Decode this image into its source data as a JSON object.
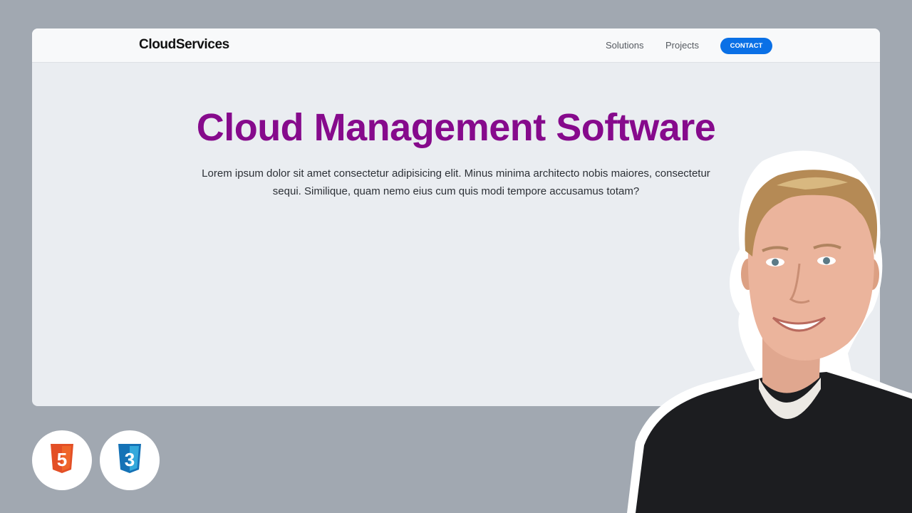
{
  "navbar": {
    "brand": "CloudServices",
    "links": [
      {
        "label": "Solutions"
      },
      {
        "label": "Projects"
      }
    ],
    "cta_label": "CONTACT"
  },
  "hero": {
    "title": "Cloud Management Software",
    "text": "Lorem ipsum dolor sit amet consectetur adipisicing elit. Minus minima architecto nobis maiores, consectetur sequi. Similique, quam nemo eius cum quis modi tempore accusamus totam?"
  },
  "badges": [
    {
      "icon": "html5-icon",
      "glyph": "5"
    },
    {
      "icon": "css3-icon",
      "glyph": "3"
    }
  ],
  "colors": {
    "page_background": "#a1a8b1",
    "title": "#860a8c",
    "cta": "#0a70e6",
    "html5": "#e34f26",
    "css3": "#1572b6"
  }
}
